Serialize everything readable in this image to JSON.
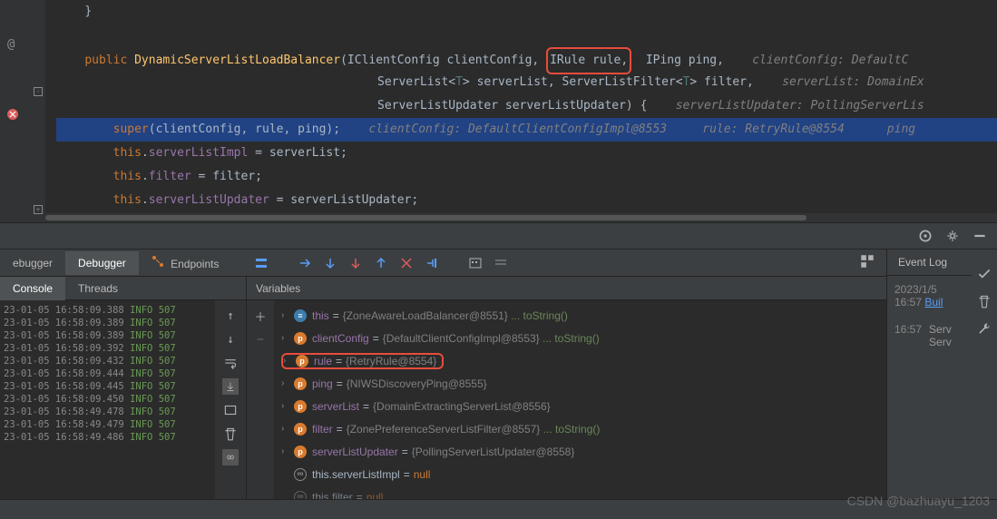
{
  "editor": {
    "lines": {
      "l1": {
        "public": "public",
        "cls": "DynamicServerListLoadBalancer",
        "p1": "(IClientConfig clientConfig,",
        "p2": "IRule rule,",
        "p3": "IPing ping,",
        "hint1": "clientConfig: DefaultC"
      },
      "l2": {
        "p1": "ServerList<",
        "gen": "T",
        "p1b": "> serverList, ServerListFilter<",
        "gen2": "T",
        "p1c": "> filter,",
        "hint1": "serverList: DomainEx"
      },
      "l3": {
        "p1": "ServerListUpdater serverListUpdater) {",
        "hint1": "serverListUpdater: PollingServerLis"
      },
      "l4": {
        "super": "super",
        "args": "(clientConfig, rule, ping);",
        "hint1": "clientConfig: DefaultClientConfigImpl@8553",
        "hint2": "rule: RetryRule@8554",
        "hint3": "ping"
      },
      "l5": {
        "this": "this",
        "field": "serverListImpl",
        "rest": " = serverList;"
      },
      "l6": {
        "this": "this",
        "field": "filter",
        "rest": " = filter;"
      },
      "l7": {
        "this": "this",
        "field": "serverListUpdater",
        "rest": " = serverListUpdater;"
      }
    }
  },
  "tabs": {
    "debugger1": "ebugger",
    "debugger2": "Debugger",
    "endpoints": "Endpoints",
    "console": "Console",
    "threads": "Threads",
    "variables": "Variables",
    "eventlog": "Event Log"
  },
  "logs": [
    {
      "ts": "23-01-05 16:58:09.388",
      "lvl": "INFO",
      "rest": "507"
    },
    {
      "ts": "23-01-05 16:58:09.389",
      "lvl": "INFO",
      "rest": "507"
    },
    {
      "ts": "23-01-05 16:58:09.389",
      "lvl": "INFO",
      "rest": "507"
    },
    {
      "ts": "23-01-05 16:58:09.392",
      "lvl": "INFO",
      "rest": "507"
    },
    {
      "ts": "23-01-05 16:58:09.432",
      "lvl": "INFO",
      "rest": "507"
    },
    {
      "ts": "23-01-05 16:58:09.444",
      "lvl": "INFO",
      "rest": "507"
    },
    {
      "ts": "23-01-05 16:58:09.445",
      "lvl": "INFO",
      "rest": "507"
    },
    {
      "ts": "23-01-05 16:58:09.450",
      "lvl": "INFO",
      "rest": "507"
    },
    {
      "ts": "23-01-05 16:58:49.478",
      "lvl": "INFO",
      "rest": "507"
    },
    {
      "ts": "23-01-05 16:58:49.479",
      "lvl": "INFO",
      "rest": "507"
    },
    {
      "ts": "23-01-05 16:58:49.486",
      "lvl": "INFO",
      "rest": "507"
    }
  ],
  "vars": {
    "this": {
      "name": "this",
      "val": "{ZoneAwareLoadBalancer@8551}",
      "dots": "...",
      "tostring": "toString()"
    },
    "clientConfig": {
      "name": "clientConfig",
      "val": "{DefaultClientConfigImpl@8553}",
      "dots": "...",
      "tostring": "toString()"
    },
    "rule": {
      "name": "rule",
      "val": "{RetryRule@8554}"
    },
    "ping": {
      "name": "ping",
      "val": "{NIWSDiscoveryPing@8555}"
    },
    "serverList": {
      "name": "serverList",
      "val": "{DomainExtractingServerList@8556}"
    },
    "filter": {
      "name": "filter",
      "val": "{ZonePreferenceServerListFilter@8557}",
      "dots": "...",
      "tostring": "toString()"
    },
    "serverListUpdater": {
      "name": "serverListUpdater",
      "val": "{PollingServerListUpdater@8558}"
    },
    "tsli": {
      "name": "this.serverListImpl",
      "val": "null"
    },
    "tfilter": {
      "name": "this.filter",
      "val": "null"
    }
  },
  "events": {
    "date": "2023/1/5",
    "e1": {
      "time": "16:57",
      "link": "Buil"
    },
    "e2": {
      "time": "16:57",
      "text1": "Serv",
      "text2": "Serv"
    }
  },
  "watermark": "CSDN @bazhuayu_1203"
}
